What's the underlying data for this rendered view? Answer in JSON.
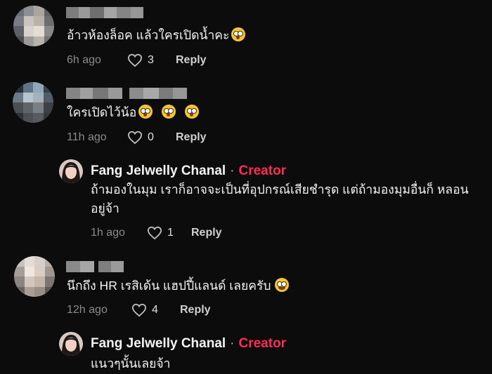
{
  "comments": [
    {
      "text": "อ้าวห้องล็อค แล้วใครเปิดน้ำคะ",
      "emojis": [
        "flushed-emoji"
      ],
      "time": "6h ago",
      "likes": "3",
      "reply": "Reply"
    },
    {
      "text": "ใครเปิดไว้น้อ",
      "emojis": [
        "flushed-emoji",
        "flushed-emoji",
        "flushed-emoji"
      ],
      "time": "11h ago",
      "likes": "0",
      "reply": "Reply"
    },
    {
      "author": "Fang Jelwelly Chanal",
      "separator": "·",
      "tag": "Creator",
      "line1": "ถ้ามองในมุม เราก็อาจจะเป็นที่อุปกรณ์เสียชำรุด แต่ถ้ามองมุมอื่นก็ หลอน",
      "line2": "อยู่จ้า",
      "time": "1h ago",
      "likes": "1",
      "reply": "Reply"
    },
    {
      "text": "นึกถึง HR เรสิเด้น แฮปปี้แลนด์ เลยครับ",
      "emojis": [
        "grinning-sweat-emoji"
      ],
      "time": "12h ago",
      "likes": "4",
      "reply": "Reply"
    },
    {
      "author": "Fang Jelwelly Chanal",
      "separator": "·",
      "tag": "Creator",
      "text": "แนวๆนั้นเลยจ้า"
    }
  ],
  "colors": {
    "background": "#0c0c0c",
    "creator_tag": "#fe2c55",
    "meta": "#8a8a8a"
  }
}
